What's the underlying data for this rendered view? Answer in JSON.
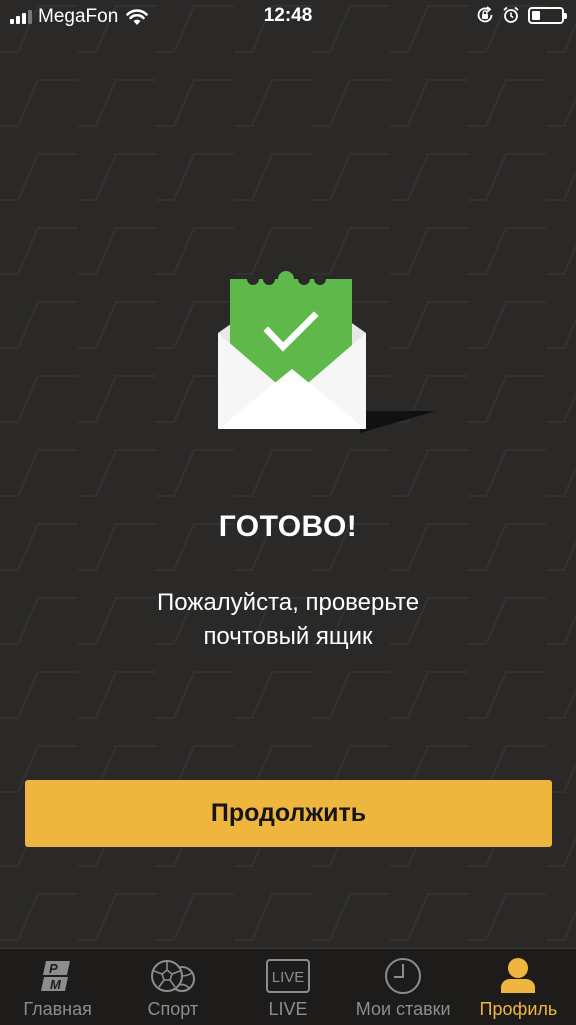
{
  "status_bar": {
    "carrier": "MegaFon",
    "time": "12:48",
    "signal_bars": 4,
    "signal_active": 3,
    "battery_level": 0.3,
    "icons": [
      "wifi-icon",
      "orientation-lock-icon",
      "alarm-icon",
      "battery-icon"
    ]
  },
  "illustration": {
    "icon": "envelope-check-icon",
    "colors": {
      "envelope": "#f3f3f3",
      "ticket": "#5fb84a",
      "check": "#ffffff",
      "shadow": "#111111"
    }
  },
  "main": {
    "title": "ГОТОВО!",
    "message_line1": "Пожалуйста, проверьте",
    "message_line2": "почтовый ящик",
    "continue_label": "Продолжить"
  },
  "tab_bar": {
    "items": [
      {
        "label": "Главная",
        "icon": "pm-logo-icon",
        "active": false
      },
      {
        "label": "Спорт",
        "icon": "sport-balls-icon",
        "active": false
      },
      {
        "label": "LIVE",
        "icon": "live-icon",
        "icon_text": "LIVE",
        "active": false
      },
      {
        "label": "Мои ставки",
        "icon": "clock-icon",
        "active": false
      },
      {
        "label": "Профиль",
        "icon": "profile-icon",
        "active": true
      }
    ]
  },
  "colors": {
    "background": "#2a2928",
    "accent": "#efb63f",
    "tab_bar": "#1d1c1b",
    "tab_inactive": "#8d8d8d",
    "success": "#5fb84a"
  }
}
